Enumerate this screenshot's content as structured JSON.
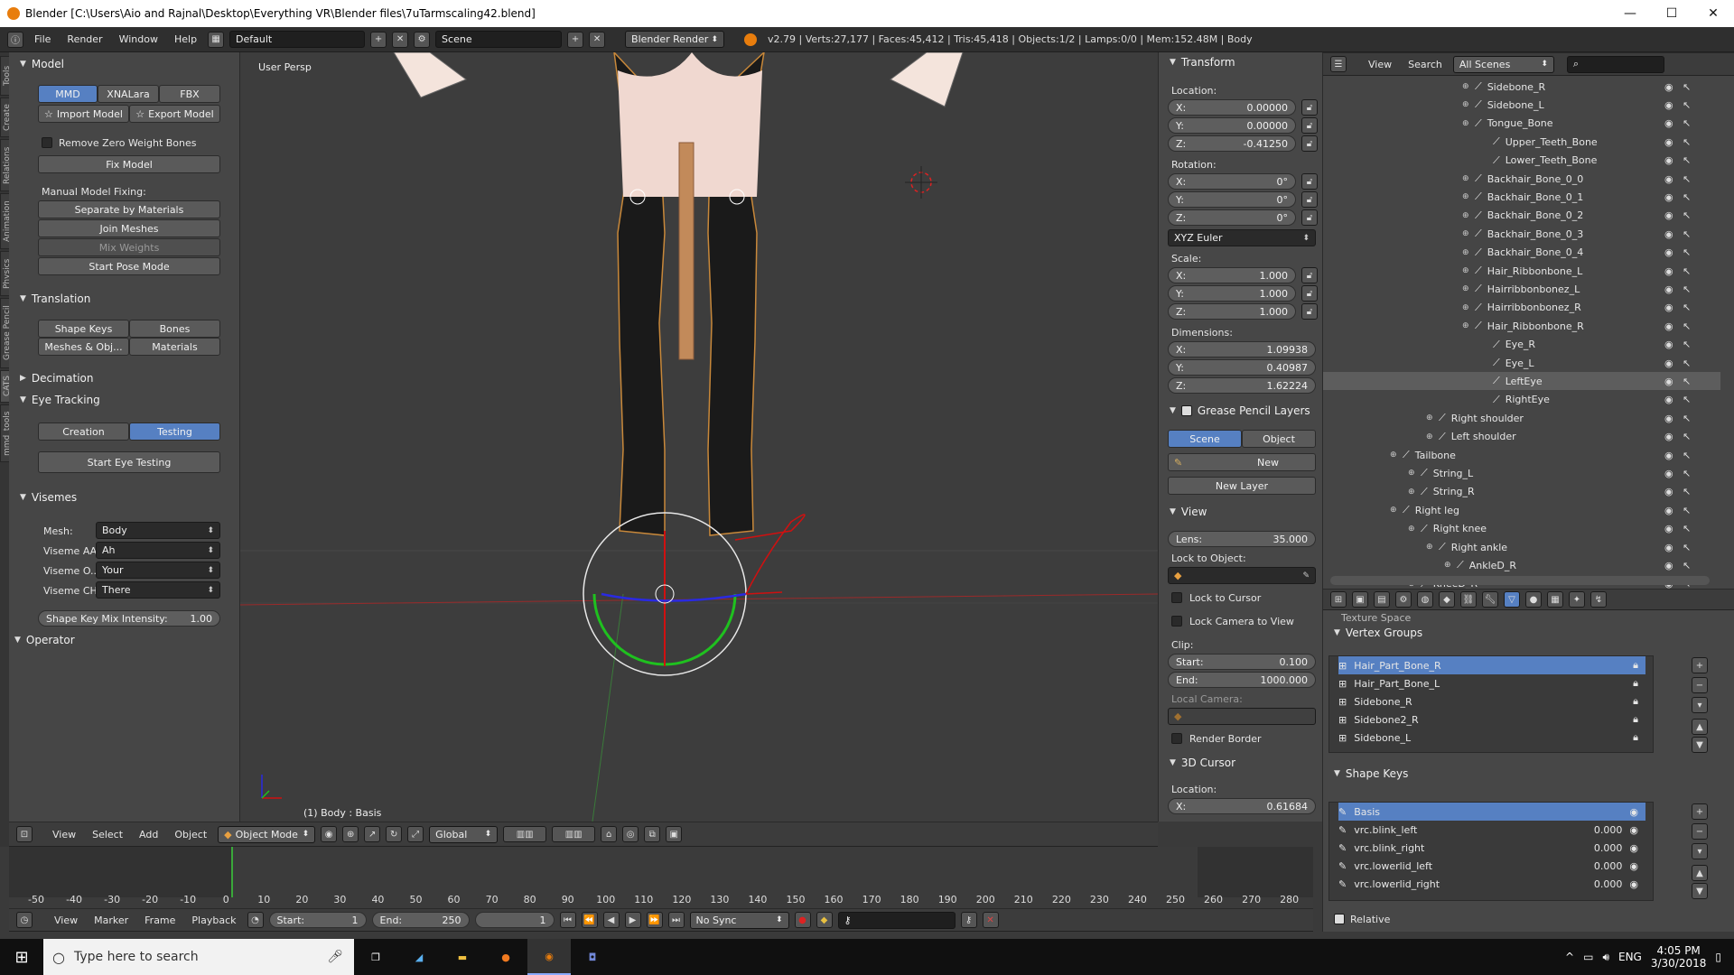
{
  "window": {
    "title": "Blender [C:\\Users\\Aio and Rajnal\\Desktop\\Everything VR\\Blender files\\7uTarmscaling42.blend]",
    "minimize": "—",
    "maximize": "☐",
    "close": "✕"
  },
  "infobar": {
    "menus": [
      "File",
      "Render",
      "Window",
      "Help"
    ],
    "layout": "Default",
    "scene": "Scene",
    "engine": "Blender Render",
    "stats": "v2.79 | Verts:27,177 | Faces:45,412 | Tris:45,418 | Objects:1/2 | Lamps:0/0 | Mem:152.48M | Body"
  },
  "lefttabs": [
    "Tools",
    "Create",
    "Relations",
    "Animation",
    "Physics",
    "Grease Pencil",
    "CATS",
    "mmd_tools"
  ],
  "toolpanel": {
    "model_header": "Model",
    "import_tabs": [
      "MMD",
      "XNALara",
      "FBX"
    ],
    "import_model": "Import Model",
    "export_model": "Export Model",
    "remove_zero_weight": "Remove Zero Weight Bones",
    "fix_model": "Fix Model",
    "manual_fixing_label": "Manual Model Fixing:",
    "separate_by_materials": "Separate by Materials",
    "join_meshes": "Join Meshes",
    "mix_weights": "Mix Weights",
    "start_pose_mode": "Start Pose Mode",
    "translation_header": "Translation",
    "shape_keys": "Shape Keys",
    "bones": "Bones",
    "meshes_obj": "Meshes & Obj...",
    "materials": "Materials",
    "decimation_header": "Decimation",
    "eye_tracking_header": "Eye Tracking",
    "creation": "Creation",
    "testing": "Testing",
    "start_eye_testing": "Start Eye Testing",
    "visemes_header": "Visemes",
    "mesh_label": "Mesh:",
    "mesh_value": "Body",
    "viseme_aa_label": "Viseme AA",
    "viseme_aa_value": "Ah",
    "viseme_oh_label": "Viseme O...",
    "viseme_oh_value": "Your",
    "viseme_ch_label": "Viseme CH",
    "viseme_ch_value": "There",
    "mix_intensity_label": "Shape Key Mix Intensity:",
    "mix_intensity_value": "1.00",
    "operator_header": "Operator"
  },
  "viewport": {
    "view_name": "User Persp",
    "object_info": "(1) Body : Basis"
  },
  "viewport_header": {
    "menus": [
      "View",
      "Select",
      "Add",
      "Object"
    ],
    "mode": "Object Mode",
    "orientation": "Global"
  },
  "npanel": {
    "transform": "Transform",
    "location_label": "Location:",
    "loc_x": "0.00000",
    "loc_y": "0.00000",
    "loc_z": "-0.41250",
    "rotation_label": "Rotation:",
    "rot_x": "0°",
    "rot_y": "0°",
    "rot_z": "0°",
    "rot_mode": "XYZ Euler",
    "scale_label": "Scale:",
    "scale_x": "1.000",
    "scale_y": "1.000",
    "scale_z": "1.000",
    "dimensions_label": "Dimensions:",
    "dim_x": "1.09938",
    "dim_y": "0.40987",
    "dim_z": "1.62224",
    "grease_pencil_layers": "Grease Pencil Layers",
    "scene_tab": "Scene",
    "object_tab": "Object",
    "new": "New",
    "new_layer": "New Layer",
    "view": "View",
    "lens_label": "Lens:",
    "lens_value": "35.000",
    "lock_to_object": "Lock to Object:",
    "lock_to_cursor": "Lock to Cursor",
    "lock_camera_to_view": "Lock Camera to View",
    "clip_label": "Clip:",
    "clip_start_label": "Start:",
    "clip_start": "0.100",
    "clip_end_label": "End:",
    "clip_end": "1000.000",
    "local_camera": "Local Camera:",
    "render_border": "Render Border",
    "cursor_3d": "3D Cursor",
    "cursor_location": "Location:",
    "cursor_x": "0.61684",
    "axis_x": "X:",
    "axis_y": "Y:",
    "axis_z": "Z:"
  },
  "outliner": {
    "menus": [
      "View",
      "Search"
    ],
    "scope": "All Scenes",
    "rows": [
      {
        "label": "Sidebone_R",
        "indent": 4
      },
      {
        "label": "Sidebone_L",
        "indent": 4
      },
      {
        "label": "Tongue_Bone",
        "indent": 4
      },
      {
        "label": "Upper_Teeth_Bone",
        "indent": 5
      },
      {
        "label": "Lower_Teeth_Bone",
        "indent": 5
      },
      {
        "label": "Backhair_Bone_0_0",
        "indent": 4
      },
      {
        "label": "Backhair_Bone_0_1",
        "indent": 4
      },
      {
        "label": "Backhair_Bone_0_2",
        "indent": 4
      },
      {
        "label": "Backhair_Bone_0_3",
        "indent": 4
      },
      {
        "label": "Backhair_Bone_0_4",
        "indent": 4
      },
      {
        "label": "Hair_Ribbonbone_L",
        "indent": 4
      },
      {
        "label": "Hairribbonbonez_L",
        "indent": 4
      },
      {
        "label": "Hairribbonbonez_R",
        "indent": 4
      },
      {
        "label": "Hair_Ribbonbone_R",
        "indent": 4
      },
      {
        "label": "Eye_R",
        "indent": 5
      },
      {
        "label": "Eye_L",
        "indent": 5
      },
      {
        "label": "LeftEye",
        "indent": 5
      },
      {
        "label": "RightEye",
        "indent": 5
      },
      {
        "label": "Right shoulder",
        "indent": 2
      },
      {
        "label": "Left shoulder",
        "indent": 2
      },
      {
        "label": "Tailbone",
        "indent": 0
      },
      {
        "label": "String_L",
        "indent": 1
      },
      {
        "label": "String_R",
        "indent": 1
      },
      {
        "label": "Right leg",
        "indent": 0
      },
      {
        "label": "Right knee",
        "indent": 1
      },
      {
        "label": "Right ankle",
        "indent": 2
      },
      {
        "label": "AnkleD_R",
        "indent": 3
      },
      {
        "label": "KneeD_R",
        "indent": 1
      }
    ]
  },
  "props": {
    "texture_space": "Texture Space",
    "vertex_groups": "Vertex Groups",
    "vg_items": [
      "Hair_Part_Bone_R",
      "Hair_Part_Bone_L",
      "Sidebone_R",
      "Sidebone2_R",
      "Sidebone_L"
    ],
    "shape_keys": "Shape Keys",
    "sk_items": [
      {
        "name": "Basis",
        "value": ""
      },
      {
        "name": "vrc.blink_left",
        "value": "0.000"
      },
      {
        "name": "vrc.blink_right",
        "value": "0.000"
      },
      {
        "name": "vrc.lowerlid_left",
        "value": "0.000"
      },
      {
        "name": "vrc.lowerlid_right",
        "value": "0.000"
      }
    ],
    "relative": "Relative"
  },
  "timeline": {
    "ticks": [
      "-50",
      "-40",
      "-30",
      "-20",
      "-10",
      "0",
      "10",
      "20",
      "30",
      "40",
      "50",
      "60",
      "70",
      "80",
      "90",
      "100",
      "110",
      "120",
      "130",
      "140",
      "150",
      "160",
      "170",
      "180",
      "190",
      "200",
      "210",
      "220",
      "230",
      "240",
      "250",
      "260",
      "270",
      "280"
    ],
    "menus": [
      "View",
      "Marker",
      "Frame",
      "Playback"
    ],
    "start_label": "Start:",
    "start": "1",
    "end_label": "End:",
    "end": "250",
    "current": "1",
    "sync": "No Sync"
  },
  "taskbar": {
    "search_placeholder": "Type here to search",
    "lang": "ENG",
    "time": "4:05 PM",
    "date": "3/30/2018"
  },
  "colors": {
    "accent": "#5680c2",
    "blender_orange": "#e87d0d"
  }
}
